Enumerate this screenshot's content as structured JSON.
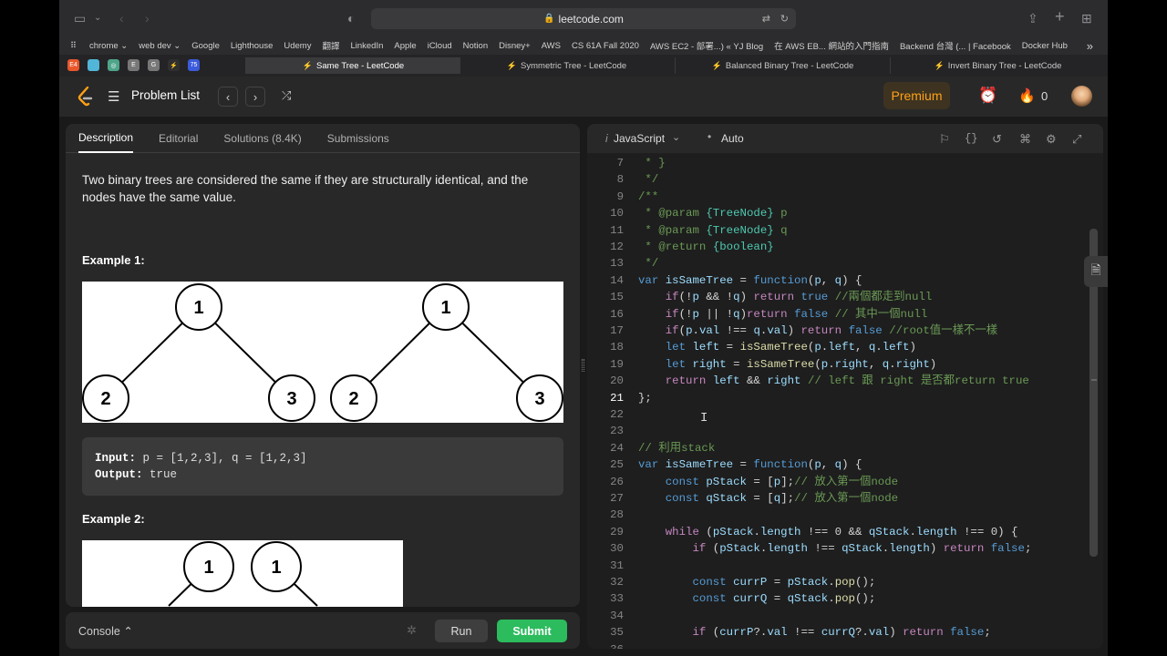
{
  "browser": {
    "url": "leetcode.com",
    "bookmarks": [
      "chrome ⌄",
      "web dev ⌄",
      "Google",
      "Lighthouse",
      "Udemy",
      "翻譯",
      "LinkedIn",
      "Apple",
      "iCloud",
      "Notion",
      "Disney+",
      "AWS",
      "CS 61A Fall 2020",
      "AWS EC2 - 部署...) « YJ Blog",
      "在 AWS EB... 網站的入門指南",
      "Backend 台灣 (... | Facebook",
      "Docker Hub"
    ],
    "pinned_tabs": [
      {
        "label": "E4",
        "color": "#e8562a"
      },
      {
        "label": "",
        "color": "#52b6d8"
      },
      {
        "label": "◎",
        "color": "#4fa58a"
      },
      {
        "label": "E",
        "color": "#777777"
      },
      {
        "label": "G",
        "color": "#777777"
      },
      {
        "label": "⚡",
        "color": "#2f2f2f"
      },
      {
        "label": "75",
        "color": "#3b5bdb"
      }
    ],
    "tabs": [
      {
        "title": "Same Tree - LeetCode",
        "active": true
      },
      {
        "title": "Symmetric Tree - LeetCode",
        "active": false
      },
      {
        "title": "Balanced Binary Tree - LeetCode",
        "active": false
      },
      {
        "title": "Invert Binary Tree - LeetCode",
        "active": false
      }
    ]
  },
  "header": {
    "problem_list": "Problem List",
    "premium": "Premium",
    "streak": "0"
  },
  "left": {
    "tabs": [
      "Description",
      "Editorial",
      "Solutions (8.4K)",
      "Submissions"
    ],
    "description": "Two binary trees are considered the same if they are structurally identical, and the nodes have the same value.",
    "example1": {
      "title": "Example 1:",
      "tree_p": {
        "root": "1",
        "left": "2",
        "right": "3"
      },
      "tree_q": {
        "root": "1",
        "left": "2",
        "right": "3"
      },
      "input_label": "Input:",
      "input_value": " p = [1,2,3], q = [1,2,3]",
      "output_label": "Output:",
      "output_value": " true"
    },
    "example2": {
      "title": "Example 2:",
      "nodes": [
        "1",
        "1"
      ]
    }
  },
  "console": {
    "label": "Console ⌃",
    "run": "Run",
    "submit": "Submit"
  },
  "editor": {
    "language": "JavaScript",
    "mode": "Auto",
    "current_line": 21,
    "lines": [
      {
        "n": "7",
        "tokens": [
          [
            "c",
            " * }"
          ]
        ]
      },
      {
        "n": "8",
        "tokens": [
          [
            "c",
            " */"
          ]
        ]
      },
      {
        "n": "9",
        "tokens": [
          [
            "c",
            "/**"
          ]
        ]
      },
      {
        "n": "10",
        "tokens": [
          [
            "c",
            " * "
          ],
          [
            "c",
            "@param"
          ],
          [
            "c",
            " "
          ],
          [
            "t",
            "{TreeNode}"
          ],
          [
            "c",
            " p"
          ]
        ]
      },
      {
        "n": "11",
        "tokens": [
          [
            "c",
            " * "
          ],
          [
            "c",
            "@param"
          ],
          [
            "c",
            " "
          ],
          [
            "t",
            "{TreeNode}"
          ],
          [
            "c",
            " q"
          ]
        ]
      },
      {
        "n": "12",
        "tokens": [
          [
            "c",
            " * "
          ],
          [
            "c",
            "@return"
          ],
          [
            "c",
            " "
          ],
          [
            "t",
            "{boolean}"
          ]
        ]
      },
      {
        "n": "13",
        "tokens": [
          [
            "c",
            " */"
          ]
        ]
      },
      {
        "n": "14",
        "tokens": [
          [
            "k",
            "var "
          ],
          [
            "v",
            "isSameTree"
          ],
          [
            "p",
            " = "
          ],
          [
            "k",
            "function"
          ],
          [
            "p",
            "("
          ],
          [
            "v",
            "p"
          ],
          [
            "p",
            ", "
          ],
          [
            "v",
            "q"
          ],
          [
            "p",
            ") {"
          ]
        ]
      },
      {
        "n": "15",
        "tokens": [
          [
            "p",
            "    "
          ],
          [
            "ctl",
            "if"
          ],
          [
            "p",
            "(!"
          ],
          [
            "v",
            "p"
          ],
          [
            "p",
            " && !"
          ],
          [
            "v",
            "q"
          ],
          [
            "p",
            ") "
          ],
          [
            "ctl",
            "return"
          ],
          [
            "p",
            " "
          ],
          [
            "k",
            "true"
          ],
          [
            "p",
            " "
          ],
          [
            "c",
            "//兩個都走到null"
          ]
        ]
      },
      {
        "n": "16",
        "tokens": [
          [
            "p",
            "    "
          ],
          [
            "ctl",
            "if"
          ],
          [
            "p",
            "(!"
          ],
          [
            "v",
            "p"
          ],
          [
            "p",
            " || !"
          ],
          [
            "v",
            "q"
          ],
          [
            "p",
            ")"
          ],
          [
            "ctl",
            "return"
          ],
          [
            "p",
            " "
          ],
          [
            "k",
            "false"
          ],
          [
            "p",
            " "
          ],
          [
            "c",
            "// 其中一個null"
          ]
        ]
      },
      {
        "n": "17",
        "tokens": [
          [
            "p",
            "    "
          ],
          [
            "ctl",
            "if"
          ],
          [
            "p",
            "("
          ],
          [
            "v",
            "p"
          ],
          [
            "p",
            "."
          ],
          [
            "v",
            "val"
          ],
          [
            "p",
            " !== "
          ],
          [
            "v",
            "q"
          ],
          [
            "p",
            "."
          ],
          [
            "v",
            "val"
          ],
          [
            "p",
            ") "
          ],
          [
            "ctl",
            "return"
          ],
          [
            "p",
            " "
          ],
          [
            "k",
            "false"
          ],
          [
            "p",
            " "
          ],
          [
            "c",
            "//root值一樣不一樣"
          ]
        ]
      },
      {
        "n": "18",
        "tokens": [
          [
            "p",
            "    "
          ],
          [
            "k",
            "let "
          ],
          [
            "v",
            "left"
          ],
          [
            "p",
            " = "
          ],
          [
            "f",
            "isSameTree"
          ],
          [
            "p",
            "("
          ],
          [
            "v",
            "p"
          ],
          [
            "p",
            "."
          ],
          [
            "v",
            "left"
          ],
          [
            "p",
            ", "
          ],
          [
            "v",
            "q"
          ],
          [
            "p",
            "."
          ],
          [
            "v",
            "left"
          ],
          [
            "p",
            ")"
          ]
        ]
      },
      {
        "n": "19",
        "tokens": [
          [
            "p",
            "    "
          ],
          [
            "k",
            "let "
          ],
          [
            "v",
            "right"
          ],
          [
            "p",
            " = "
          ],
          [
            "f",
            "isSameTree"
          ],
          [
            "p",
            "("
          ],
          [
            "v",
            "p"
          ],
          [
            "p",
            "."
          ],
          [
            "v",
            "right"
          ],
          [
            "p",
            ", "
          ],
          [
            "v",
            "q"
          ],
          [
            "p",
            "."
          ],
          [
            "v",
            "right"
          ],
          [
            "p",
            ")"
          ]
        ]
      },
      {
        "n": "20",
        "tokens": [
          [
            "p",
            "    "
          ],
          [
            "ctl",
            "return"
          ],
          [
            "p",
            " "
          ],
          [
            "v",
            "left"
          ],
          [
            "p",
            " && "
          ],
          [
            "v",
            "right"
          ],
          [
            "p",
            " "
          ],
          [
            "c",
            "// left 跟 right 是否都return true"
          ]
        ]
      },
      {
        "n": "21",
        "tokens": [
          [
            "p",
            "};"
          ]
        ]
      },
      {
        "n": "22",
        "tokens": []
      },
      {
        "n": "23",
        "tokens": []
      },
      {
        "n": "24",
        "tokens": [
          [
            "c",
            "// 利用stack"
          ]
        ]
      },
      {
        "n": "25",
        "tokens": [
          [
            "k",
            "var "
          ],
          [
            "v",
            "isSameTree"
          ],
          [
            "p",
            " = "
          ],
          [
            "k",
            "function"
          ],
          [
            "p",
            "("
          ],
          [
            "v",
            "p"
          ],
          [
            "p",
            ", "
          ],
          [
            "v",
            "q"
          ],
          [
            "p",
            ") {"
          ]
        ]
      },
      {
        "n": "26",
        "tokens": [
          [
            "p",
            "    "
          ],
          [
            "k",
            "const "
          ],
          [
            "v",
            "pStack"
          ],
          [
            "p",
            " = ["
          ],
          [
            "v",
            "p"
          ],
          [
            "p",
            "];"
          ],
          [
            "c",
            "// 放入第一個node"
          ]
        ]
      },
      {
        "n": "27",
        "tokens": [
          [
            "p",
            "    "
          ],
          [
            "k",
            "const "
          ],
          [
            "v",
            "qStack"
          ],
          [
            "p",
            " = ["
          ],
          [
            "v",
            "q"
          ],
          [
            "p",
            "];"
          ],
          [
            "c",
            "// 放入第一個node"
          ]
        ]
      },
      {
        "n": "28",
        "tokens": []
      },
      {
        "n": "29",
        "tokens": [
          [
            "p",
            "    "
          ],
          [
            "ctl",
            "while"
          ],
          [
            "p",
            " ("
          ],
          [
            "v",
            "pStack"
          ],
          [
            "p",
            "."
          ],
          [
            "v",
            "length"
          ],
          [
            "p",
            " !== 0 && "
          ],
          [
            "v",
            "qStack"
          ],
          [
            "p",
            "."
          ],
          [
            "v",
            "length"
          ],
          [
            "p",
            " !== 0) {"
          ]
        ]
      },
      {
        "n": "30",
        "tokens": [
          [
            "p",
            "        "
          ],
          [
            "ctl",
            "if"
          ],
          [
            "p",
            " ("
          ],
          [
            "v",
            "pStack"
          ],
          [
            "p",
            "."
          ],
          [
            "v",
            "length"
          ],
          [
            "p",
            " !== "
          ],
          [
            "v",
            "qStack"
          ],
          [
            "p",
            "."
          ],
          [
            "v",
            "length"
          ],
          [
            "p",
            ") "
          ],
          [
            "ctl",
            "return"
          ],
          [
            "p",
            " "
          ],
          [
            "k",
            "false"
          ],
          [
            "p",
            ";"
          ]
        ]
      },
      {
        "n": "31",
        "tokens": []
      },
      {
        "n": "32",
        "tokens": [
          [
            "p",
            "        "
          ],
          [
            "k",
            "const "
          ],
          [
            "v",
            "currP"
          ],
          [
            "p",
            " = "
          ],
          [
            "v",
            "pStack"
          ],
          [
            "p",
            "."
          ],
          [
            "f",
            "pop"
          ],
          [
            "p",
            "();"
          ]
        ]
      },
      {
        "n": "33",
        "tokens": [
          [
            "p",
            "        "
          ],
          [
            "k",
            "const "
          ],
          [
            "v",
            "currQ"
          ],
          [
            "p",
            " = "
          ],
          [
            "v",
            "qStack"
          ],
          [
            "p",
            "."
          ],
          [
            "f",
            "pop"
          ],
          [
            "p",
            "();"
          ]
        ]
      },
      {
        "n": "34",
        "tokens": []
      },
      {
        "n": "35",
        "tokens": [
          [
            "p",
            "        "
          ],
          [
            "ctl",
            "if"
          ],
          [
            "p",
            " ("
          ],
          [
            "v",
            "currP"
          ],
          [
            "p",
            "?."
          ],
          [
            "v",
            "val"
          ],
          [
            "p",
            " !== "
          ],
          [
            "v",
            "currQ"
          ],
          [
            "p",
            "?."
          ],
          [
            "v",
            "val"
          ],
          [
            "p",
            ") "
          ],
          [
            "ctl",
            "return"
          ],
          [
            "p",
            " "
          ],
          [
            "k",
            "false"
          ],
          [
            "p",
            ";"
          ]
        ]
      },
      {
        "n": "36",
        "tokens": []
      }
    ]
  }
}
